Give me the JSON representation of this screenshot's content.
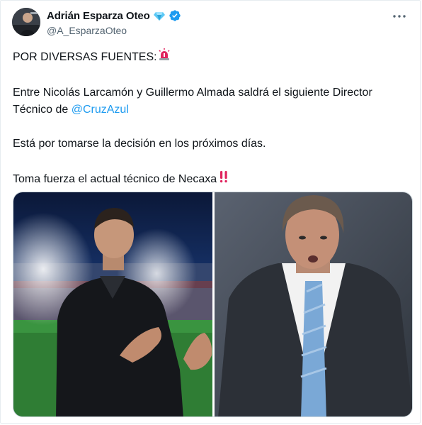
{
  "tweet": {
    "author": {
      "display_name": "Adrián Esparza Oteo",
      "handle": "@A_EsparzaOteo",
      "badge_icon": "diamond-icon",
      "verified_icon": "verified-badge-icon"
    },
    "more_icon": "more-options-icon",
    "text": {
      "line1": "POR DIVERSAS FUENTES:",
      "line1_emoji": "siren-icon",
      "line2a": "Entre Nicolás Larcamón y Guillermo Almada saldrá el siguiente Director",
      "line2b_prefix": "Técnico de ",
      "mention": "@CruzAzul",
      "line3": "Está por tomarse la decisión en los próximos días.",
      "line4": "Toma fuerza el actual técnico de Necaxa",
      "line4_emoji": "double-exclamation-icon"
    },
    "media": [
      {
        "name": "photo-left",
        "subject": "coach in stadium"
      },
      {
        "name": "photo-right",
        "subject": "coach in suit"
      }
    ],
    "colors": {
      "mention": "#1d9bf0",
      "verified": "#1d9bf0",
      "secondary_text": "#536471",
      "emoji_red": "#e0245e"
    }
  }
}
